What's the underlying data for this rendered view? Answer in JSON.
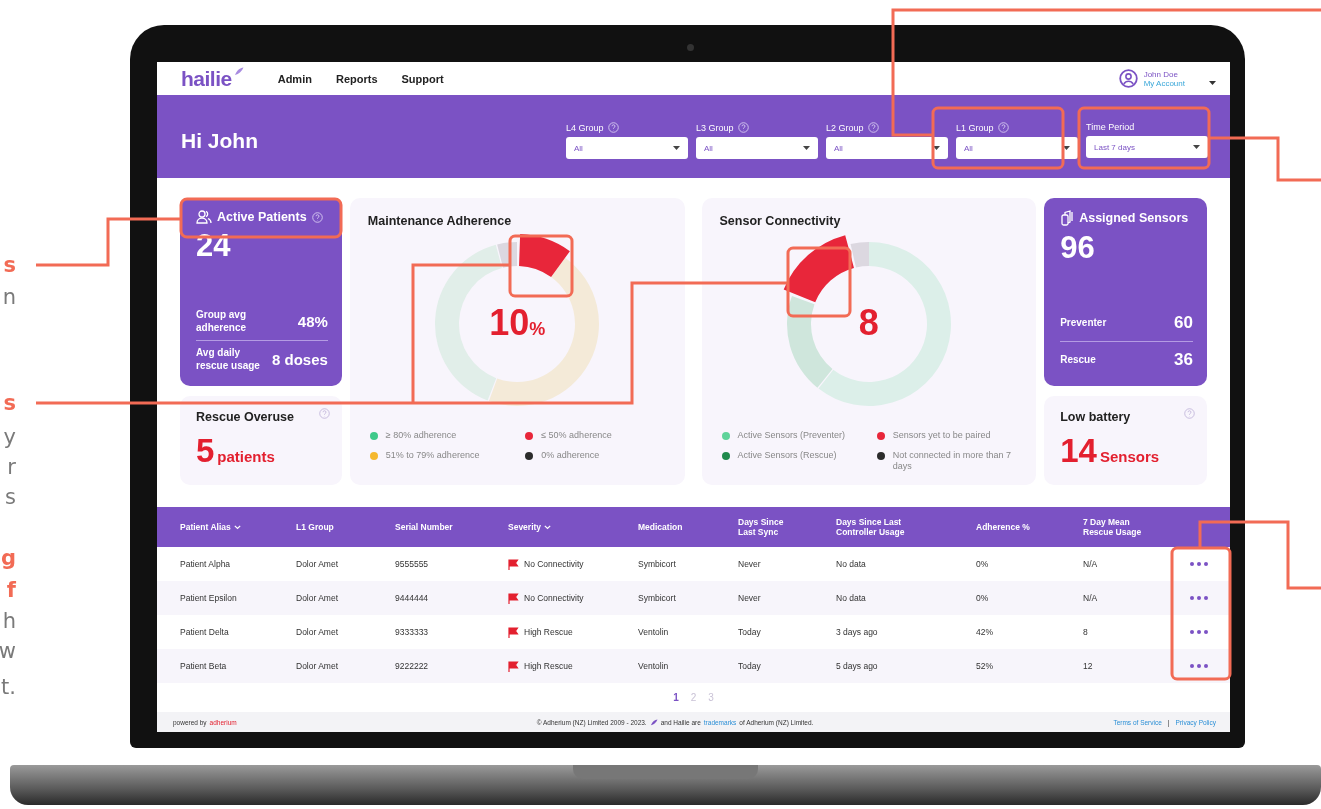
{
  "annotations": [
    {
      "text": "s",
      "kind": "heading"
    },
    {
      "text": "n",
      "kind": "body"
    },
    {
      "text": "s",
      "kind": "heading"
    },
    {
      "text": "y",
      "kind": "body"
    },
    {
      "text": "r",
      "kind": "body"
    },
    {
      "text": "s",
      "kind": "body"
    },
    {
      "text": "g",
      "kind": "heading"
    },
    {
      "text": "f",
      "kind": "heading"
    },
    {
      "text": "h",
      "kind": "body"
    },
    {
      "text": "w",
      "kind": "body"
    },
    {
      "text": "t.",
      "kind": "body"
    }
  ],
  "nav": {
    "logo": "hailie",
    "links": [
      "Admin",
      "Reports",
      "Support"
    ],
    "user": {
      "name": "John Doe",
      "account": "My Account"
    }
  },
  "header": {
    "greeting": "Hi John",
    "filters": [
      {
        "label": "L4 Group",
        "value": "All",
        "help": true
      },
      {
        "label": "L3 Group",
        "value": "All",
        "help": true
      },
      {
        "label": "L2 Group",
        "value": "All",
        "help": true
      },
      {
        "label": "L1 Group",
        "value": "All",
        "help": true
      },
      {
        "label": "Time Period",
        "value": "Last 7 days",
        "help": false
      }
    ]
  },
  "active_patients": {
    "title": "Active Patients",
    "count": "24",
    "stats": [
      {
        "label": "Group avg adherence",
        "value": "48%"
      },
      {
        "label": "Avg daily rescue usage",
        "value": "8 doses"
      }
    ]
  },
  "rescue_overuse": {
    "title": "Rescue Overuse",
    "value": "5",
    "unit": "patients"
  },
  "maintenance": {
    "title": "Maintenance Adherence",
    "value": "10",
    "unit": "%",
    "legend": [
      {
        "label": "≥ 80% adherence",
        "color": "#3ec98a"
      },
      {
        "label": "≤ 50% adherence",
        "color": "#e8263a"
      },
      {
        "label": "51% to 79% adherence",
        "color": "#f5b82e"
      },
      {
        "label": "0% adherence",
        "color": "#2b2b2b"
      }
    ]
  },
  "sensor": {
    "title": "Sensor Connectivity",
    "value": "8",
    "legend": [
      {
        "label": "Active Sensors (Preventer)",
        "color": "#5fd39a"
      },
      {
        "label": "Sensors yet to be paired",
        "color": "#e8263a"
      },
      {
        "label": "Active Sensors (Rescue)",
        "color": "#1f8a4c"
      },
      {
        "label": "Not connected in more than 7 days",
        "color": "#2b2b2b"
      }
    ]
  },
  "assigned": {
    "title": "Assigned Sensors",
    "count": "96",
    "stats": [
      {
        "label": "Preventer",
        "value": "60"
      },
      {
        "label": "Rescue",
        "value": "36"
      }
    ]
  },
  "low_battery": {
    "title": "Low battery",
    "value": "14",
    "unit": "Sensors"
  },
  "table": {
    "columns": [
      {
        "label": "Patient Alias",
        "sortable": true
      },
      {
        "label": "L1 Group",
        "sortable": false
      },
      {
        "label": "Serial Number",
        "sortable": false
      },
      {
        "label": "Severity",
        "sortable": true
      },
      {
        "label": "Medication",
        "sortable": false
      },
      {
        "label": "Days Since Last Sync",
        "sortable": false
      },
      {
        "label": "Days Since Last Controller Usage",
        "sortable": false
      },
      {
        "label": "Adherence %",
        "sortable": false
      },
      {
        "label": "7 Day Mean Rescue Usage",
        "sortable": false
      }
    ],
    "rows": [
      {
        "cells": [
          "Patient Alpha",
          "Dolor Amet",
          "9555555",
          "No Connectivity",
          "Symbicort",
          "Never",
          "No data",
          "0%",
          "N/A"
        ]
      },
      {
        "cells": [
          "Patient Epsilon",
          "Dolor Amet",
          "9444444",
          "No Connectivity",
          "Symbicort",
          "Never",
          "No data",
          "0%",
          "N/A"
        ]
      },
      {
        "cells": [
          "Patient Delta",
          "Dolor Amet",
          "9333333",
          "High Rescue",
          "Ventolin",
          "Today",
          "3 days ago",
          "42%",
          "8"
        ]
      },
      {
        "cells": [
          "Patient Beta",
          "Dolor Amet",
          "9222222",
          "High Rescue",
          "Ventolin",
          "Today",
          "5 days ago",
          "52%",
          "12"
        ]
      }
    ]
  },
  "pagination": [
    {
      "label": "1",
      "selected": true
    },
    {
      "label": "2",
      "selected": false
    },
    {
      "label": "3",
      "selected": false
    }
  ],
  "footer": {
    "powered_by": "powered by",
    "brand": "adherium",
    "copyright": "© Adherium (NZ) Limited 2009 - 2023.",
    "trademark_pre": "and Hailie are",
    "trademark_link": "trademarks",
    "trademark_post": "of Adherium (NZ) Limited.",
    "links": [
      "Terms of Service",
      "Privacy Policy"
    ],
    "separator": "|"
  }
}
